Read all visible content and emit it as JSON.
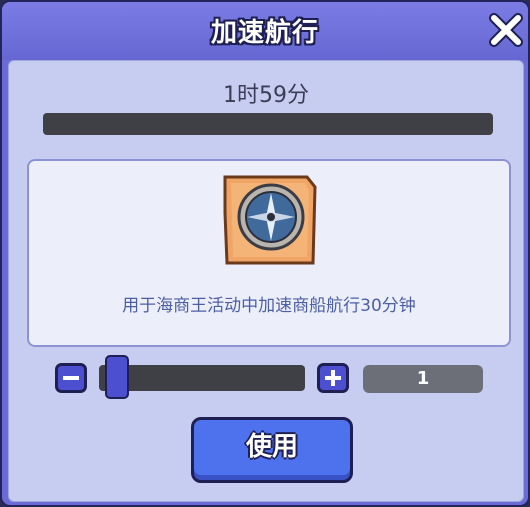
{
  "dialog": {
    "title": "加速航行",
    "close_icon": "close-icon"
  },
  "timer": {
    "text": "1时59分",
    "progress": 0
  },
  "item": {
    "icon": "compass-icon",
    "description": "用于海商王活动中加速商船航行30分钟"
  },
  "quantity": {
    "minus_icon": "minus-icon",
    "plus_icon": "plus-icon",
    "value": "1"
  },
  "actions": {
    "use_label": "使用"
  },
  "colors": {
    "header": "#6a6bd6",
    "panel": "#c7cdf0",
    "button": "#4e72ee",
    "outline": "#1e1f52"
  }
}
